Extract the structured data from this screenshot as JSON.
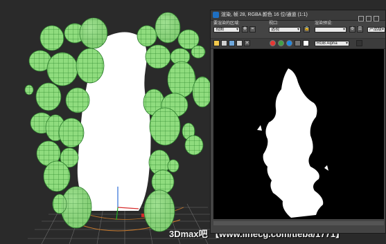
{
  "framebuffer": {
    "title": "渲染, 帧 28, RGBA 颜色 16 位/通道 (1:1)",
    "area_to_render_label": "要渲染的区域:",
    "area_to_render_value": "视图",
    "viewport_label": "视口:",
    "viewport_value": "透视",
    "render_preset_label": "渲染预设:",
    "render_preset_value": "",
    "product_level_value": "产品级",
    "channel_display_value": "RGB Alpha",
    "channel_colors": {
      "red": "#e53935",
      "green": "#43a047",
      "blue": "#1e88e5"
    }
  },
  "watermark": {
    "text": "3Dmax吧 【www.linecg.com/tieba/1771】"
  },
  "scene": {
    "background": "#2a2a2a",
    "ball_color": "#7bd36b",
    "wire_color": "#2f8a2f",
    "cutout_color": "#ffffff"
  }
}
